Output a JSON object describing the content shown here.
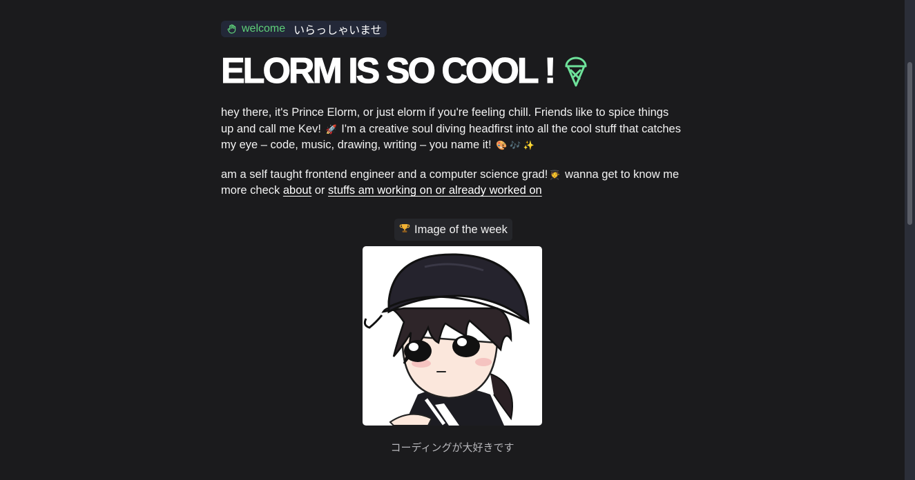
{
  "badge": {
    "welcome": "welcome",
    "japanese": "いらっしゃいませ",
    "icon": "waving-hand-icon"
  },
  "heading": {
    "title": "ELORM IS SO COOL !",
    "icon": "ice-cream-icon",
    "accent_color": "#6ee29a"
  },
  "intro": {
    "line1": "hey there, it's Prince Elorm, or just elorm if you're feeling chill. Friends like to spice things up and call me Kev! ",
    "rocket": "🚀",
    "line2": " I'm a creative soul diving headfirst into all the cool stuff that catches my eye – code, music, drawing, writing – you name it! ",
    "emojis": "🎨 🎶 ✨"
  },
  "bio": {
    "text_before": "am a self taught frontend engineer and a computer science grad!",
    "grad_emoji": "🧑‍🎓",
    "text_mid": " wanna get to know me more check ",
    "about_link": "about",
    "or_text": " or ",
    "work_link": "stuffs am working on or already worked on"
  },
  "image_of_week": {
    "label": "Image of the week",
    "icon": "trophy-icon",
    "caption": "コーディングが大好きです"
  },
  "colors": {
    "background": "#1b1b1d",
    "badge_bg": "#232838",
    "green": "#5fd27a"
  }
}
